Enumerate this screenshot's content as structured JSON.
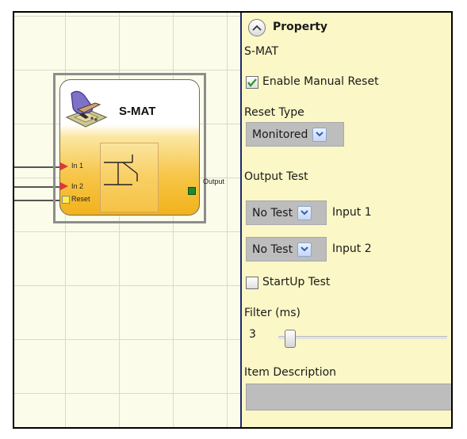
{
  "canvas": {
    "block": {
      "title": "S-MAT",
      "inputs": [
        {
          "label": "In 1"
        },
        {
          "label": "In 2"
        },
        {
          "label": "Reset"
        }
      ],
      "output_label": "Output"
    }
  },
  "panel": {
    "title": "Property",
    "component_name": "S-MAT",
    "enable_manual_reset": {
      "label": "Enable Manual Reset",
      "checked": true
    },
    "reset_type": {
      "label": "Reset Type",
      "value": "Monitored"
    },
    "output_test": {
      "label": "Output Test",
      "rows": [
        {
          "value": "No Test",
          "suffix": "Input 1"
        },
        {
          "value": "No Test",
          "suffix": "Input 2"
        }
      ]
    },
    "startup_test": {
      "label": "StartUp Test",
      "checked": false
    },
    "filter": {
      "label": "Filter (ms)",
      "value": "3"
    },
    "item_description": {
      "label": "Item Description",
      "value": ""
    }
  },
  "colors": {
    "panel_bg": "#fbf7c6",
    "canvas_bg": "#fbfcea",
    "block_gradient_bottom": "#f2b21b",
    "input_pin": "#e23535",
    "reset_pin": "#ffef4d",
    "output_pin": "#1d8a2c",
    "check_mark": "#2e9a2e",
    "dropdown_arrow": "#2b5fb3",
    "divider": "#1f2a6b"
  },
  "icons": [
    "collapse-up-icon",
    "checkmark-icon",
    "chevron-down-icon",
    "reset-hand-icon",
    "switch-contact-icon"
  ]
}
